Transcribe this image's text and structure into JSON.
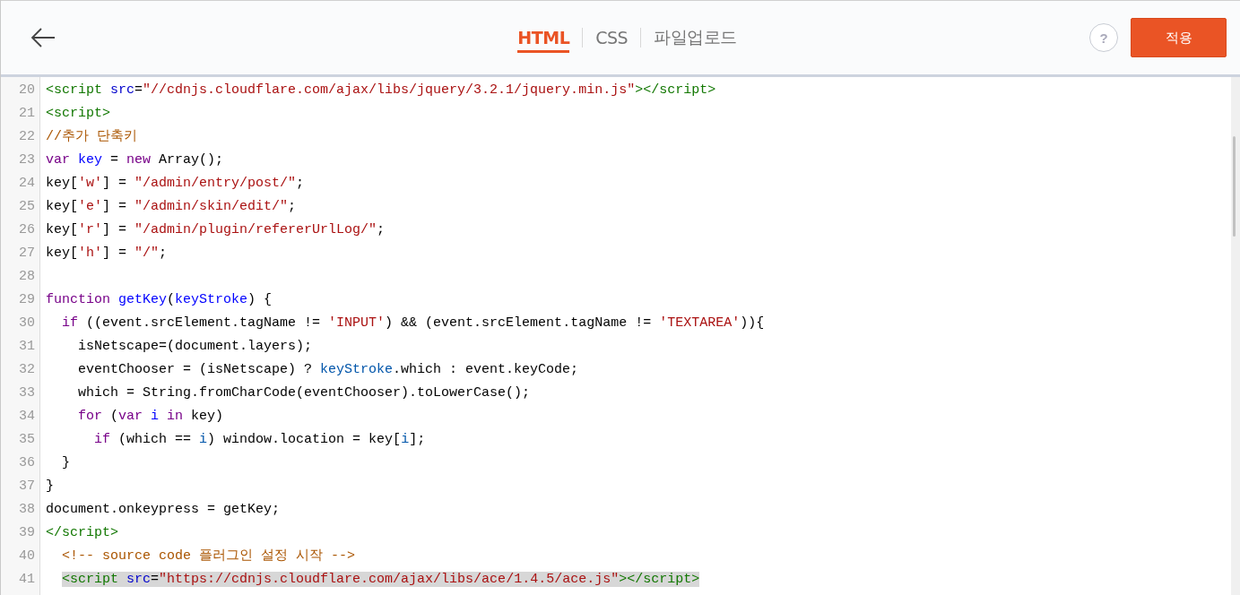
{
  "header": {
    "tabs": [
      {
        "label": "HTML",
        "selected": true
      },
      {
        "label": "CSS",
        "selected": false
      },
      {
        "label": "파일업로드",
        "selected": false
      }
    ],
    "help": "?",
    "apply": "적용"
  },
  "editor": {
    "lines": [
      {
        "number": "20",
        "highlighted": false,
        "tokens": [
          {
            "kind": "tag",
            "text": "<script"
          },
          {
            "kind": "attr",
            "text": " src"
          },
          {
            "kind": "plain",
            "text": "="
          },
          {
            "kind": "string",
            "text": "\"//cdnjs.cloudflare.com/ajax/libs/jquery/3.2.1/jquery.min.js\""
          },
          {
            "kind": "tag",
            "text": "></script>"
          }
        ]
      },
      {
        "number": "21",
        "highlighted": false,
        "tokens": [
          {
            "kind": "tag",
            "text": "<script>"
          }
        ]
      },
      {
        "number": "22",
        "highlighted": false,
        "tokens": [
          {
            "kind": "comment",
            "text": "//추가 단축키"
          }
        ]
      },
      {
        "number": "23",
        "highlighted": false,
        "tokens": [
          {
            "kind": "keyword",
            "text": "var"
          },
          {
            "kind": "def",
            "text": " key"
          },
          {
            "kind": "plain",
            "text": " = "
          },
          {
            "kind": "keyword",
            "text": "new"
          },
          {
            "kind": "plain",
            "text": " Array();"
          }
        ]
      },
      {
        "number": "24",
        "highlighted": false,
        "tokens": [
          {
            "kind": "plain",
            "text": "key["
          },
          {
            "kind": "string",
            "text": "'w'"
          },
          {
            "kind": "plain",
            "text": "] = "
          },
          {
            "kind": "string",
            "text": "\"/admin/entry/post/\""
          },
          {
            "kind": "plain",
            "text": ";"
          }
        ]
      },
      {
        "number": "25",
        "highlighted": false,
        "tokens": [
          {
            "kind": "plain",
            "text": "key["
          },
          {
            "kind": "string",
            "text": "'e'"
          },
          {
            "kind": "plain",
            "text": "] = "
          },
          {
            "kind": "string",
            "text": "\"/admin/skin/edit/\""
          },
          {
            "kind": "plain",
            "text": ";"
          }
        ]
      },
      {
        "number": "26",
        "highlighted": false,
        "tokens": [
          {
            "kind": "plain",
            "text": "key["
          },
          {
            "kind": "string",
            "text": "'r'"
          },
          {
            "kind": "plain",
            "text": "] = "
          },
          {
            "kind": "string",
            "text": "\"/admin/plugin/refererUrlLog/\""
          },
          {
            "kind": "plain",
            "text": ";"
          }
        ]
      },
      {
        "number": "27",
        "highlighted": false,
        "tokens": [
          {
            "kind": "plain",
            "text": "key["
          },
          {
            "kind": "string",
            "text": "'h'"
          },
          {
            "kind": "plain",
            "text": "] = "
          },
          {
            "kind": "string",
            "text": "\"/\""
          },
          {
            "kind": "plain",
            "text": ";"
          }
        ]
      },
      {
        "number": "28",
        "highlighted": false
      },
      {
        "number": "29",
        "highlighted": false,
        "tokens": [
          {
            "kind": "keyword",
            "text": "function"
          },
          {
            "kind": "def",
            "text": " getKey"
          },
          {
            "kind": "plain",
            "text": "("
          },
          {
            "kind": "def",
            "text": "keyStroke"
          },
          {
            "kind": "plain",
            "text": ") {"
          }
        ]
      },
      {
        "number": "30",
        "highlighted": false,
        "tokens": [
          {
            "kind": "keyword",
            "text": "  if"
          },
          {
            "kind": "plain",
            "text": " ((event.srcElement.tagName != "
          },
          {
            "kind": "string",
            "text": "'INPUT'"
          },
          {
            "kind": "plain",
            "text": ") && (event.srcElement.tagName != "
          },
          {
            "kind": "string",
            "text": "'TEXTAREA'"
          },
          {
            "kind": "plain",
            "text": ")){"
          }
        ]
      },
      {
        "number": "31",
        "highlighted": false,
        "tokens": [
          {
            "kind": "plain",
            "text": "    isNetscape=(document.layers);"
          }
        ]
      },
      {
        "number": "32",
        "highlighted": false,
        "tokens": [
          {
            "kind": "plain",
            "text": "    eventChooser = (isNetscape) ? "
          },
          {
            "kind": "variable",
            "text": "keyStroke"
          },
          {
            "kind": "plain",
            "text": ".which : event.keyCode;"
          }
        ]
      },
      {
        "number": "33",
        "highlighted": false,
        "tokens": [
          {
            "kind": "plain",
            "text": "    which = String.fromCharCode(eventChooser).toLowerCase();"
          }
        ]
      },
      {
        "number": "34",
        "highlighted": false,
        "tokens": [
          {
            "kind": "keyword",
            "text": "    for"
          },
          {
            "kind": "plain",
            "text": " ("
          },
          {
            "kind": "keyword",
            "text": "var"
          },
          {
            "kind": "def",
            "text": " i"
          },
          {
            "kind": "keyword",
            "text": " in"
          },
          {
            "kind": "plain",
            "text": " key)"
          }
        ]
      },
      {
        "number": "35",
        "highlighted": false,
        "tokens": [
          {
            "kind": "keyword",
            "text": "      if"
          },
          {
            "kind": "plain",
            "text": " (which == "
          },
          {
            "kind": "variable",
            "text": "i"
          },
          {
            "kind": "plain",
            "text": ") window.location = key["
          },
          {
            "kind": "variable",
            "text": "i"
          },
          {
            "kind": "plain",
            "text": "];"
          }
        ]
      },
      {
        "number": "36",
        "highlighted": false,
        "tokens": [
          {
            "kind": "plain",
            "text": "  }"
          }
        ]
      },
      {
        "number": "37",
        "highlighted": false,
        "tokens": [
          {
            "kind": "plain",
            "text": "}"
          }
        ]
      },
      {
        "number": "38",
        "highlighted": false,
        "tokens": [
          {
            "kind": "plain",
            "text": "document.onkeypress = getKey;"
          }
        ]
      },
      {
        "number": "39",
        "highlighted": false,
        "tokens": [
          {
            "kind": "tag",
            "text": "</script>"
          }
        ]
      },
      {
        "number": "40",
        "highlighted": false,
        "tokens": [
          {
            "kind": "comment",
            "text": "  <!-- source code 플러그인 설정 시작 -->"
          }
        ]
      },
      {
        "number": "41",
        "highlighted": true,
        "tokens": [
          {
            "kind": "tag",
            "text": "  <script"
          },
          {
            "kind": "attr",
            "text": " src"
          },
          {
            "kind": "plain",
            "text": "="
          },
          {
            "kind": "string",
            "text": "\"https://cdnjs.cloudflare.com/ajax/libs/ace/1.4.5/ace.js\""
          },
          {
            "kind": "tag",
            "text": "></script>"
          }
        ]
      }
    ]
  }
}
